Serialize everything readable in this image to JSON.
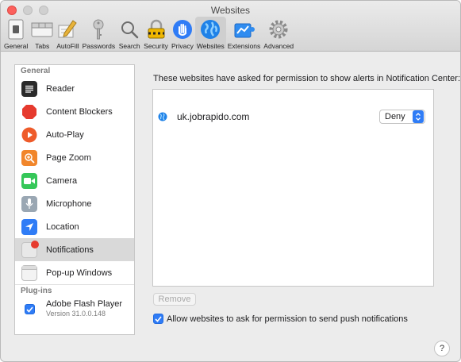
{
  "window": {
    "title": "Websites"
  },
  "toolbar": {
    "items": [
      {
        "label": "General",
        "icon": "general-icon"
      },
      {
        "label": "Tabs",
        "icon": "tabs-icon"
      },
      {
        "label": "AutoFill",
        "icon": "autofill-icon"
      },
      {
        "label": "Passwords",
        "icon": "key-icon"
      },
      {
        "label": "Search",
        "icon": "search-icon"
      },
      {
        "label": "Security",
        "icon": "lock-icon"
      },
      {
        "label": "Privacy",
        "icon": "hand-icon"
      },
      {
        "label": "Websites",
        "icon": "globe-icon",
        "active": true
      },
      {
        "label": "Extensions",
        "icon": "puzzle-icon"
      },
      {
        "label": "Advanced",
        "icon": "gear-icon"
      }
    ]
  },
  "sidebar": {
    "general_header": "General",
    "items": [
      {
        "label": "Reader",
        "icon": "reader-icon",
        "color": "#2a2a2a"
      },
      {
        "label": "Content Blockers",
        "icon": "stop-icon",
        "color": "#e63a2e"
      },
      {
        "label": "Auto-Play",
        "icon": "play-icon",
        "color": "#ee5b2a"
      },
      {
        "label": "Page Zoom",
        "icon": "zoom-icon",
        "color": "#f1862b"
      },
      {
        "label": "Camera",
        "icon": "camera-icon",
        "color": "#35c759"
      },
      {
        "label": "Microphone",
        "icon": "microphone-icon",
        "color": "#9aa7b3"
      },
      {
        "label": "Location",
        "icon": "location-icon",
        "color": "#2f7cf6"
      },
      {
        "label": "Notifications",
        "icon": "notifications-icon",
        "color": "#e8e8e8",
        "selected": true
      },
      {
        "label": "Pop-up Windows",
        "icon": "popup-icon",
        "color": "#f3f3f3"
      }
    ],
    "plugins_header": "Plug-ins",
    "plugins": [
      {
        "name": "Adobe Flash Player",
        "version": "Version 31.0.0.148",
        "enabled": true
      }
    ]
  },
  "main": {
    "description": "These websites have asked for permission to show alerts in Notification Center:",
    "sites": [
      {
        "domain": "uk.jobrapido.com",
        "permission": "Deny"
      }
    ],
    "remove_label": "Remove",
    "allow_label": "Allow websites to ask for permission to send push notifications",
    "allow_checked": true
  },
  "help": {
    "label": "?"
  },
  "colors": {
    "accent": "#2f7cf6",
    "close": "#fc605c"
  }
}
